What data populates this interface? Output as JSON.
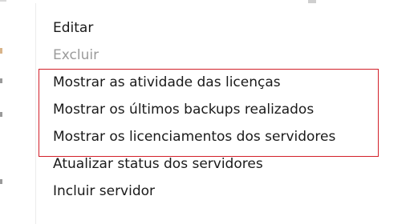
{
  "context_menu": {
    "items": [
      {
        "label": "Editar",
        "enabled": true
      },
      {
        "label": "Excluir",
        "enabled": false
      },
      {
        "label": "Mostrar as atividade das licenças",
        "enabled": true
      },
      {
        "label": "Mostrar os últimos backups realizados",
        "enabled": true
      },
      {
        "label": "Mostrar os licenciamentos dos servidores",
        "enabled": true
      },
      {
        "label": "Atualizar status dos servidores",
        "enabled": true
      },
      {
        "label": "Incluir servidor",
        "enabled": true
      }
    ],
    "highlight": {
      "items": [
        2,
        3,
        4
      ],
      "color": "#d2202a"
    }
  },
  "colors": {
    "text": "#1a1a1a",
    "disabled_text": "#9b9b9b",
    "background": "#ffffff"
  }
}
